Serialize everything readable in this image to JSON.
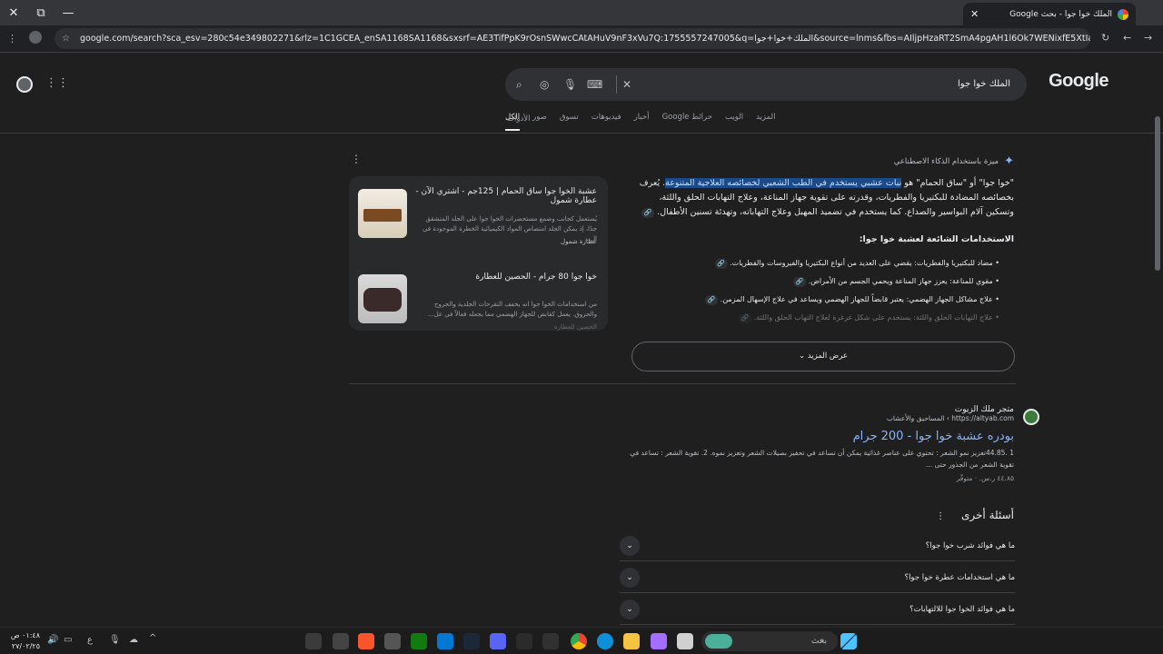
{
  "browser": {
    "tab_title": "الملك خوا جوا - بحث Google",
    "url": "google.com/search?sca_esv=280c54e349802271&rlz=1C1GCEA_enSA1168SA1168&sxsrf=AE3TifPpK9rOsnSWwcCAtAHuV9nF3xVu7Q:1755557247005&q=الملك+خوا+جوا&source=lnms&fbs=AIljpHzaRT2SmA4pgAH1l6Ok7WENixfE5XtIaQ08lx5b6TM-UsN28YyI7Qmi..."
  },
  "google": {
    "logo": "Google",
    "query": "الملك خوا جوا",
    "tabs": [
      "الكل",
      "صور",
      "تسوق",
      "فيديوهات",
      "أخبار",
      "خرائط Google",
      "الويب",
      "المزيد"
    ],
    "tools_label": "الأدوات"
  },
  "ai_overview": {
    "header": "ميزة باستخدام الذكاء الاصطناعي",
    "intro_pre": "\"خوا جوا\" أو \"ساق الحمام\" هو ",
    "intro_highlight": "نبات عشبي يستخدم في الطب الشعبي لخصائصه العلاجية المتنوعة",
    "intro_post": ". يُعرف بخصائصه المضادة للبكتيريا والفطريات، وقدرته على تقوية جهاز المناعة، وعلاج التهابات الحلق واللثة، وتسكين آلام البواسير والصداع. كما يستخدم في تضميد المهبل وعلاج التهاباته، وتهدئة تسنين الأطفال.",
    "subheading": "الاستخدامات الشائعة لعشبة خوا جوا:",
    "bullets": [
      "مضاد للبكتيريا والفطريات: يقضي على العديد من أنواع البكتيريا والفيروسات والفطريات.",
      "مقوي للمناعة: يعزز جهاز المناعة ويحمي الجسم من الأمراض.",
      "علاج مشاكل الجهاز الهضمي: يعتبر قابضاً للجهاز الهضمي ويساعد في علاج الإسهال المزمن.",
      "علاج التهابات الحلق واللثة: يستخدم على شكل غرغرة لعلاج التهاب الحلق واللثة."
    ],
    "show_more": "عرض المزيد"
  },
  "cards": [
    {
      "title": "عشبة الخوا جوا ساق الحمام | 125جم - اشتري الآن - عطارة شمول",
      "desc": "يُستعمل كجانب وضمع مستحضرات الخوا جوا على الجلد المتشقق جدًا، إذ يمكن الجلد امتصاص المواد الكيميائية الخطرة الموجودة في ال...",
      "source": "عطارة شمول"
    },
    {
      "title": "خوا جوا 80 جرام - الحصين للعطارة",
      "desc": "من استخدامات الخوا جوا انه يخفف التقرحات الجلدية والجروح والحروق. يعمل كقابض للجهاز الهضمي مما يجعله فعالاً في عل...",
      "source": "الحصين للعطارة"
    }
  ],
  "result": {
    "site_name": "متجر ملك الزيوت",
    "url": "https://altyab.com › المساحيق والأعشاب",
    "title": "بودره عشبة خوا جوا - 200 جرام",
    "snippet": "1 .44.85تعزيز نمو الشعر : تحتوي على عناصر غذائية يمكن أن تساعد في تحفيز بصيلات الشعر وتعزيز نموه. 2. تقوية الشعر : تساعد في تقوية الشعر من الجذور حتى ...",
    "price": "٤٤.٨٥ ر.س. · متوفّر"
  },
  "paa": {
    "heading": "أسئلة أخرى",
    "questions": [
      "ما هي فوائد شرب خوا جوا؟",
      "ما هي استخدامات عطرة خوا جوا؟",
      "ما هي فوائد الخوا جوا للالتهابات؟"
    ]
  },
  "taskbar": {
    "search_placeholder": "بحث",
    "time": "٠١:٤٨ ص",
    "date": "٢٧/٠٢/٢٥",
    "lang": "ع"
  }
}
